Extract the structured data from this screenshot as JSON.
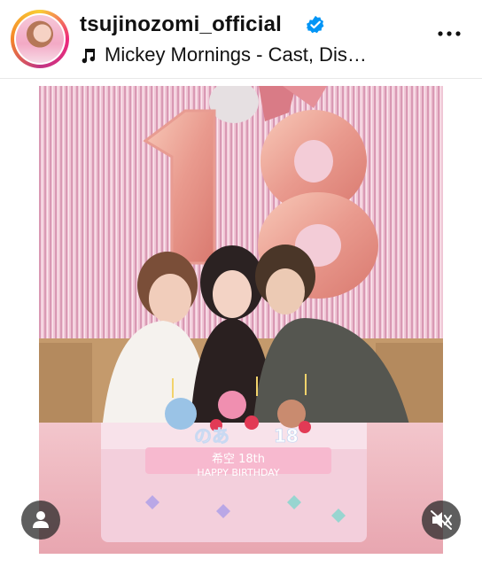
{
  "header": {
    "username": "tsujinozomi_official",
    "audio": "Mickey Mornings - Cast, Dis…",
    "verified": true
  },
  "post": {
    "balloon_number": "18",
    "cake_text_name": "のあ",
    "cake_text_number": "18",
    "cake_line1": "希空 18th",
    "cake_line2": "HAPPY BIRTHDAY"
  },
  "icons": {
    "verified": "verified-badge-icon",
    "music": "music-note-icon",
    "more": "more-options-icon",
    "tag": "user-tag-icon",
    "mute": "muted-speaker-icon"
  },
  "colors": {
    "verified_blue": "#0095f6",
    "ring": [
      "#f9ce34",
      "#ee2a7b",
      "#c13584"
    ]
  }
}
